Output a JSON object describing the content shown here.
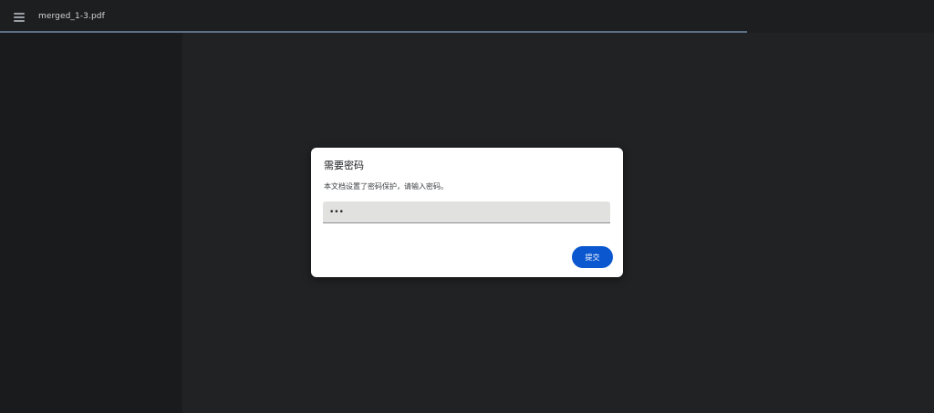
{
  "toolbar": {
    "menu_icon": "menu-icon",
    "document_title": "merged_1-3.pdf",
    "load_progress": 0.8
  },
  "password_dialog": {
    "title": "需要密码",
    "message": "本文档设置了密码保护，请输入密码。",
    "password_value": "•••",
    "submit_label": "提交"
  },
  "colors": {
    "toolbar_bg": "#1d1e20",
    "sidebar_bg": "#1a1b1c",
    "viewer_bg": "#212224",
    "dialog_bg": "#ffffff",
    "accent_button": "#0b57d0",
    "input_bg": "#e1e2df"
  }
}
